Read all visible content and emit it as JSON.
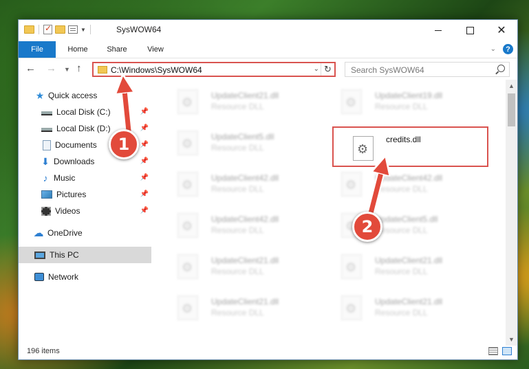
{
  "window": {
    "title": "SysWOW64",
    "controls": {
      "minimize": "—",
      "maximize": "☐",
      "close": "✕"
    }
  },
  "ribbon": {
    "tabs": [
      "File",
      "Home",
      "Share",
      "View"
    ],
    "help": "?"
  },
  "nav": {
    "address": "C:\\Windows\\SysWOW64",
    "search_placeholder": "Search SysWOW64"
  },
  "sidebar": {
    "items": [
      {
        "label": "Quick access",
        "icon": "star-icon",
        "pinned": false
      },
      {
        "label": "Local Disk (C:)",
        "icon": "drive-icon",
        "pinned": true
      },
      {
        "label": "Local Disk (D:)",
        "icon": "drive-icon",
        "pinned": true
      },
      {
        "label": "Documents",
        "icon": "documents-icon",
        "pinned": true
      },
      {
        "label": "Downloads",
        "icon": "downloads-icon",
        "pinned": true
      },
      {
        "label": "Music",
        "icon": "music-icon",
        "pinned": true
      },
      {
        "label": "Pictures",
        "icon": "pictures-icon",
        "pinned": true
      },
      {
        "label": "Videos",
        "icon": "videos-icon",
        "pinned": true
      },
      {
        "label": "OneDrive",
        "icon": "cloud-icon",
        "pinned": false
      },
      {
        "label": "This PC",
        "icon": "computer-icon",
        "pinned": false,
        "selected": true
      },
      {
        "label": "Network",
        "icon": "network-icon",
        "pinned": false
      }
    ]
  },
  "files": {
    "left_column": [
      {
        "name": "UpdateClient21.dll",
        "type": "Resource DLL"
      },
      {
        "name": "UpdateClient5.dll",
        "type": "Resource DLL"
      },
      {
        "name": "UpdateClient42.dll",
        "type": "Resource DLL"
      },
      {
        "name": "UpdateClient42.dll",
        "type": "Resource DLL"
      },
      {
        "name": "UpdateClient21.dll",
        "type": "Resource DLL"
      },
      {
        "name": "UpdateClient21.dll",
        "type": "Resource DLL"
      }
    ],
    "right_column": [
      {
        "name": "UpdateClient19.dll",
        "type": "Resource DLL"
      },
      {
        "name": "credits.dll",
        "type": ""
      },
      {
        "name": "UpdateClient42.dll",
        "type": "Resource DLL"
      },
      {
        "name": "UpdateClient5.dll",
        "type": "Resource DLL"
      },
      {
        "name": "UpdateClient21.dll",
        "type": "Resource DLL"
      },
      {
        "name": "UpdateClient21.dll",
        "type": "Resource DLL"
      }
    ]
  },
  "status": {
    "item_count": "196 items"
  },
  "annotations": {
    "step1": "1",
    "step2": "2",
    "highlight_color": "#d9534f"
  }
}
